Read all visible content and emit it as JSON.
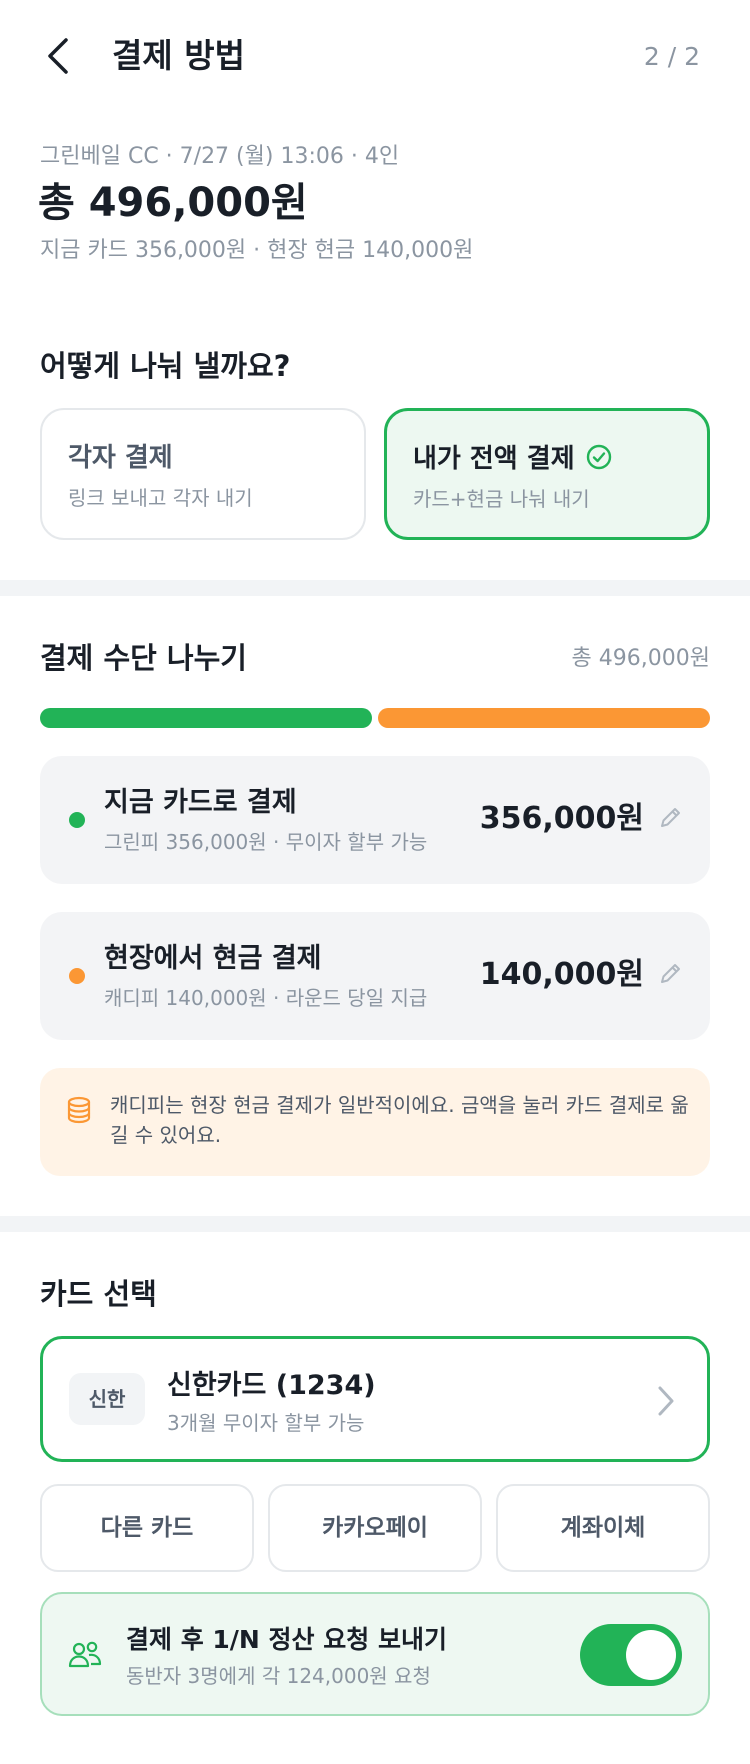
{
  "header": {
    "title": "결제 방법",
    "step": "2 / 2"
  },
  "summary": {
    "meta": "그린베일 CC · 7/27 (월) 13:06 · 4인",
    "total": "총 496,000원",
    "split": "지금 카드 356,000원 · 현장 현금 140,000원"
  },
  "split_question": {
    "title": "어떻게 나눠 낼까요?",
    "options": [
      {
        "title": "각자 결제",
        "sub": "링크 보내고 각자 내기",
        "selected": false
      },
      {
        "title": "내가 전액 결제",
        "sub": "카드+현금 나눠 내기",
        "selected": true
      }
    ]
  },
  "method_split": {
    "title": "결제 수단 나누기",
    "total": "총 496,000원",
    "card_share": 0.5,
    "cash_share": 0.5,
    "colors": {
      "card": "#22b357",
      "cash": "#fb9734"
    },
    "items": [
      {
        "title": "지금 카드로 결제",
        "sub": "그린피 356,000원 · 무이자 할부 가능",
        "amount": "356,000원"
      },
      {
        "title": "현장에서 현금 결제",
        "sub": "캐디피 140,000원 · 라운드 당일 지급",
        "amount": "140,000원"
      }
    ],
    "notice": "캐디피는 현장 현금 결제가 일반적이에요. 금액을 눌러 카드 결제로 옮길 수 있어요."
  },
  "card_select": {
    "title": "카드 선택",
    "selected": {
      "bank": "신한",
      "name": "신한카드 (1234)",
      "sub": "3개월 무이자 할부 가능"
    },
    "alternatives": [
      "다른 카드",
      "카카오페이",
      "계좌이체"
    ]
  },
  "settle": {
    "title": "결제 후 1/N 정산 요청 보내기",
    "sub": "동반자 3명에게 각 124,000원 요청",
    "enabled": true
  },
  "icons": {
    "back": "chevron-left-icon",
    "check": "check-circle-icon",
    "edit": "pencil-icon",
    "notice": "coin-stack-icon",
    "card_arrow": "chevron-right-icon",
    "settle": "people-icon"
  },
  "colors": {
    "accent": "#22b357",
    "warning": "#fb9734",
    "text": "#191f28",
    "muted": "#8b95a1"
  }
}
